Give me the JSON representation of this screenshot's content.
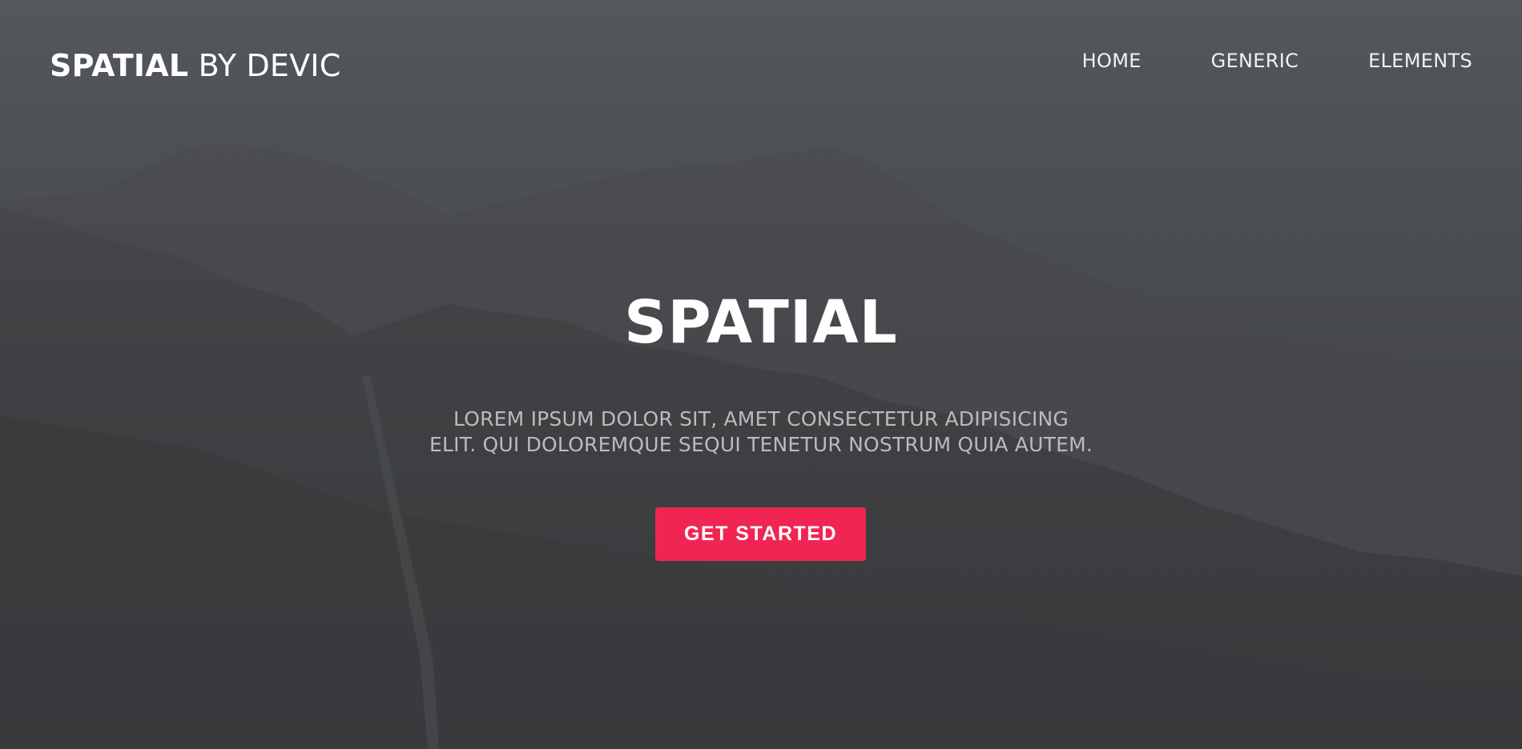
{
  "header": {
    "logo_brand": "SPATIAL",
    "logo_by": "BY DEVIC",
    "nav": [
      {
        "label": "HOME"
      },
      {
        "label": "GENERIC"
      },
      {
        "label": "ELEMENTS"
      }
    ]
  },
  "hero": {
    "title": "SPATIAL",
    "subtitle_line1": "LOREM IPSUM DOLOR SIT, AMET CONSECTETUR ADIPISICING",
    "subtitle_line2": "ELIT. QUI DOLOREMQUE SEQUI TENETUR NOSTRUM QUIA AUTEM.",
    "cta_label": "GET STARTED",
    "background_image": "misty-mountain-waterfall"
  },
  "colors": {
    "accent": "#f12552",
    "overlay": "#45484c",
    "text": "#ffffff",
    "subtext": "#b9bbbe"
  }
}
